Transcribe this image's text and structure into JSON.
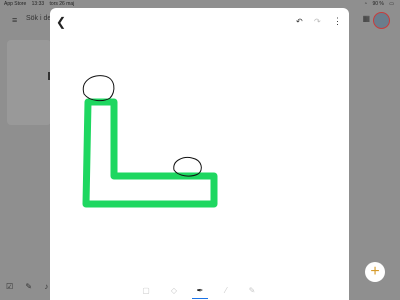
{
  "status_bar": {
    "back_app": "App Store",
    "time": "13:33",
    "date": "tors 26 maj",
    "wifi": "wifi-icon",
    "battery_percent": "90 %",
    "battery_icon": "battery-icon"
  },
  "background": {
    "search_placeholder": "Sök i de"
  },
  "drawing": {
    "stroke_color": "#1ed760",
    "outline_color": "#111111",
    "background_color": "#ffffff"
  },
  "header": {
    "back_icon": "chevron-left-icon",
    "undo_icon": "undo-icon",
    "redo_icon": "redo-icon",
    "more_icon": "more-vertical-icon"
  },
  "toolbar": {
    "tools": [
      "select-icon",
      "eraser-icon",
      "pen-icon",
      "marker-icon",
      "highlighter-icon"
    ],
    "active_tool": "pen-icon",
    "accent": "#1a73e8"
  },
  "fab": {
    "label": "+",
    "color": "#d69b2b"
  }
}
